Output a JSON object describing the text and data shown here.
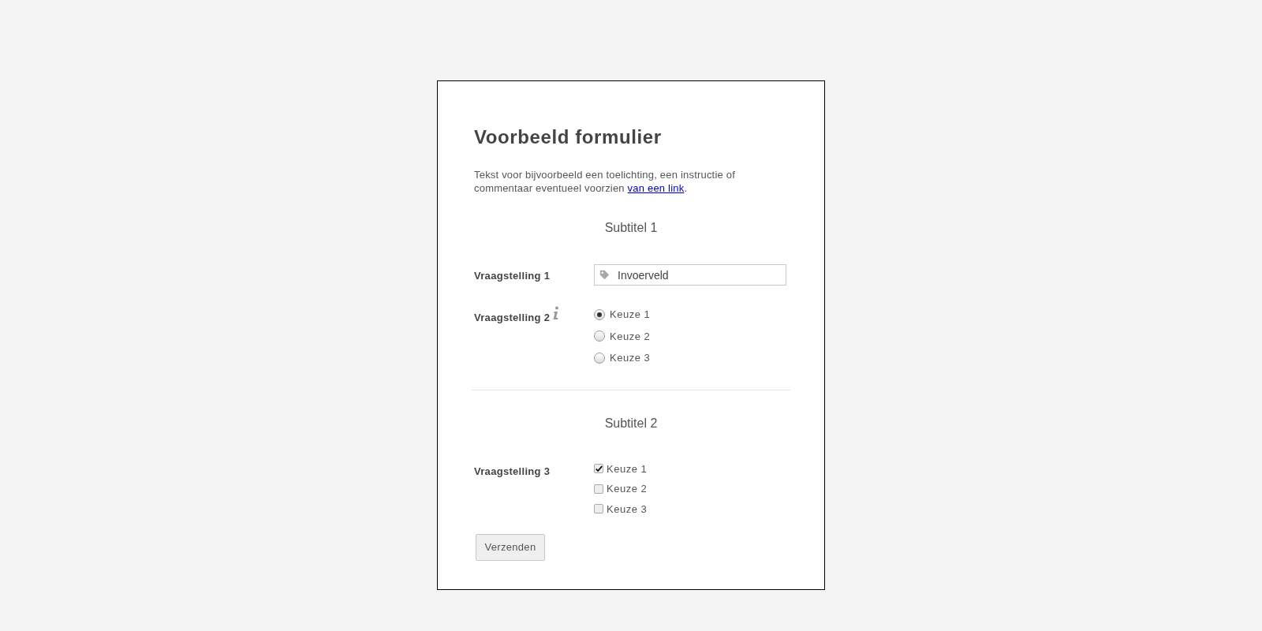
{
  "title": "Voorbeeld formulier",
  "description": {
    "text": "Tekst voor bijvoorbeeld een toelichting, een instructie of commentaar eventueel voorzien ",
    "link": "van een link",
    "after": "."
  },
  "sections": [
    {
      "subtitle": "Subtitel 1",
      "questions": [
        {
          "kind": "text",
          "label": "Vraagstelling 1",
          "info": false,
          "value": "Invoerveld"
        },
        {
          "kind": "radio",
          "label": "Vraagstelling 2",
          "info": true,
          "options": [
            {
              "label": "Keuze 1",
              "selected": true
            },
            {
              "label": "Keuze 2",
              "selected": false
            },
            {
              "label": "Keuze 3",
              "selected": false
            }
          ]
        }
      ]
    },
    {
      "subtitle": "Subtitel 2",
      "questions": [
        {
          "kind": "checkbox",
          "label": "Vraagstelling 3",
          "info": false,
          "options": [
            {
              "label": "Keuze 1",
              "checked": true
            },
            {
              "label": "Keuze 2",
              "checked": false
            },
            {
              "label": "Keuze 3",
              "checked": false
            }
          ]
        }
      ]
    }
  ],
  "submit": "Verzenden"
}
